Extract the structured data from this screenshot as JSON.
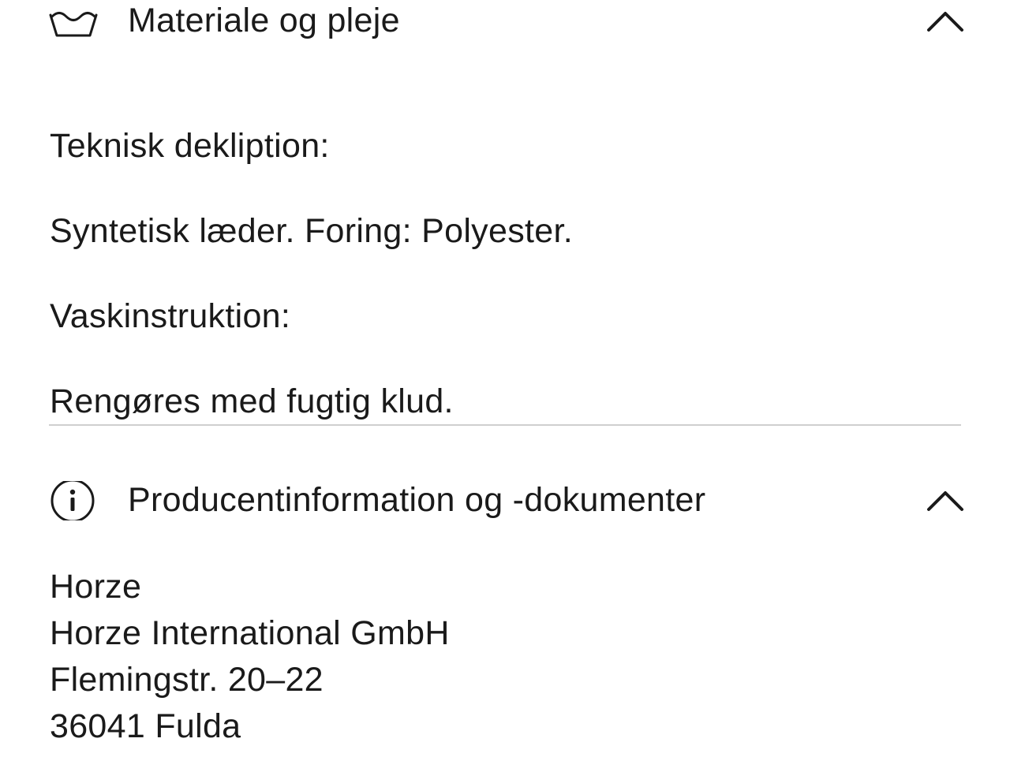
{
  "material_care": {
    "title": "Materiale og pleje",
    "icon": "wash-basin-icon",
    "expanded": true,
    "technical_label": "Teknisk dekliption:",
    "technical_value": "Syntetisk læder. Foring: Polyester.",
    "wash_label": "Vaskinstruktion:",
    "wash_value": "Rengøres med fugtig klud."
  },
  "producer_info": {
    "title": "Producentinformation og -dokumenter",
    "icon": "info-circle-icon",
    "expanded": true,
    "address_lines": [
      "Horze",
      "Horze International GmbH",
      "Flemingstr. 20–22",
      "36041 Fulda"
    ]
  },
  "colors": {
    "text": "#1a1a1a",
    "divider": "#cfcfcf",
    "background": "#ffffff"
  }
}
